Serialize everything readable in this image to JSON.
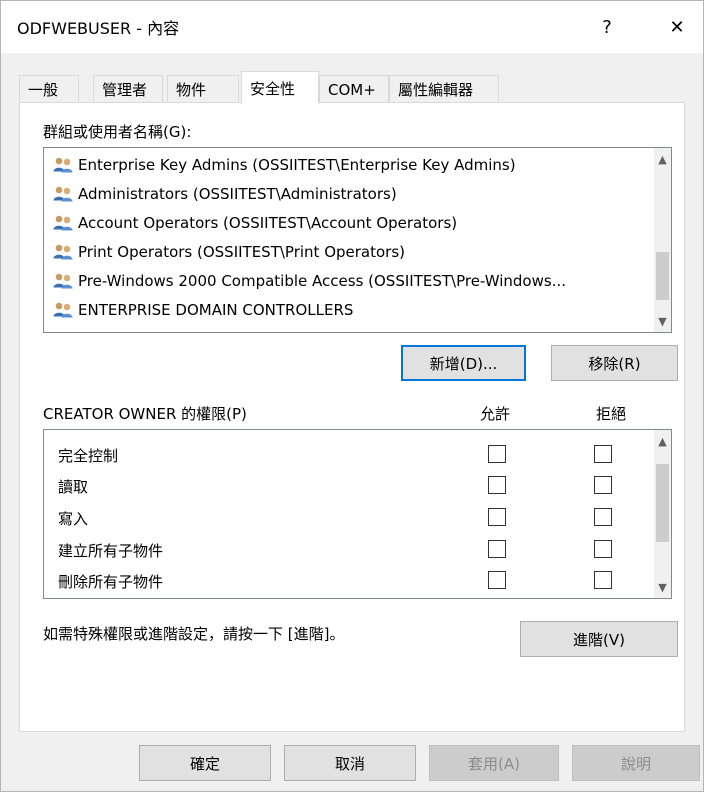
{
  "window": {
    "title": "ODFWEBUSER - 內容"
  },
  "titlebar": {
    "help_glyph": "?",
    "close_glyph": "✕"
  },
  "tabs": [
    {
      "label": "一般"
    },
    {
      "label": "管理者"
    },
    {
      "label": "物件"
    },
    {
      "label": "安全性",
      "active": true
    },
    {
      "label": "COM+"
    },
    {
      "label": "屬性編輯器"
    }
  ],
  "groups": {
    "label": "群組或使用者名稱(G):",
    "items": [
      "Enterprise Key Admins (OSSIITEST\\Enterprise Key Admins)",
      "Administrators (OSSIITEST\\Administrators)",
      "Account Operators (OSSIITEST\\Account Operators)",
      "Print Operators (OSSIITEST\\Print Operators)",
      "Pre-Windows 2000 Compatible Access (OSSIITEST\\Pre-Windows...",
      "ENTERPRISE DOMAIN CONTROLLERS"
    ],
    "add_label": "新增(D)...",
    "remove_label": "移除(R)"
  },
  "permissions": {
    "label": "CREATOR OWNER 的權限(P)",
    "allow_header": "允許",
    "deny_header": "拒絕",
    "rows": [
      {
        "name": "完全控制",
        "allow": false,
        "deny": false
      },
      {
        "name": "讀取",
        "allow": false,
        "deny": false
      },
      {
        "name": "寫入",
        "allow": false,
        "deny": false
      },
      {
        "name": "建立所有子物件",
        "allow": false,
        "deny": false
      },
      {
        "name": "刪除所有子物件",
        "allow": false,
        "deny": false
      }
    ]
  },
  "advanced": {
    "hint": "如需特殊權限或進階設定，請按一下 [進階]。",
    "button_label": "進階(V)"
  },
  "footer": {
    "ok_label": "確定",
    "cancel_label": "取消",
    "apply_label": "套用(A)",
    "help_label": "說明"
  }
}
